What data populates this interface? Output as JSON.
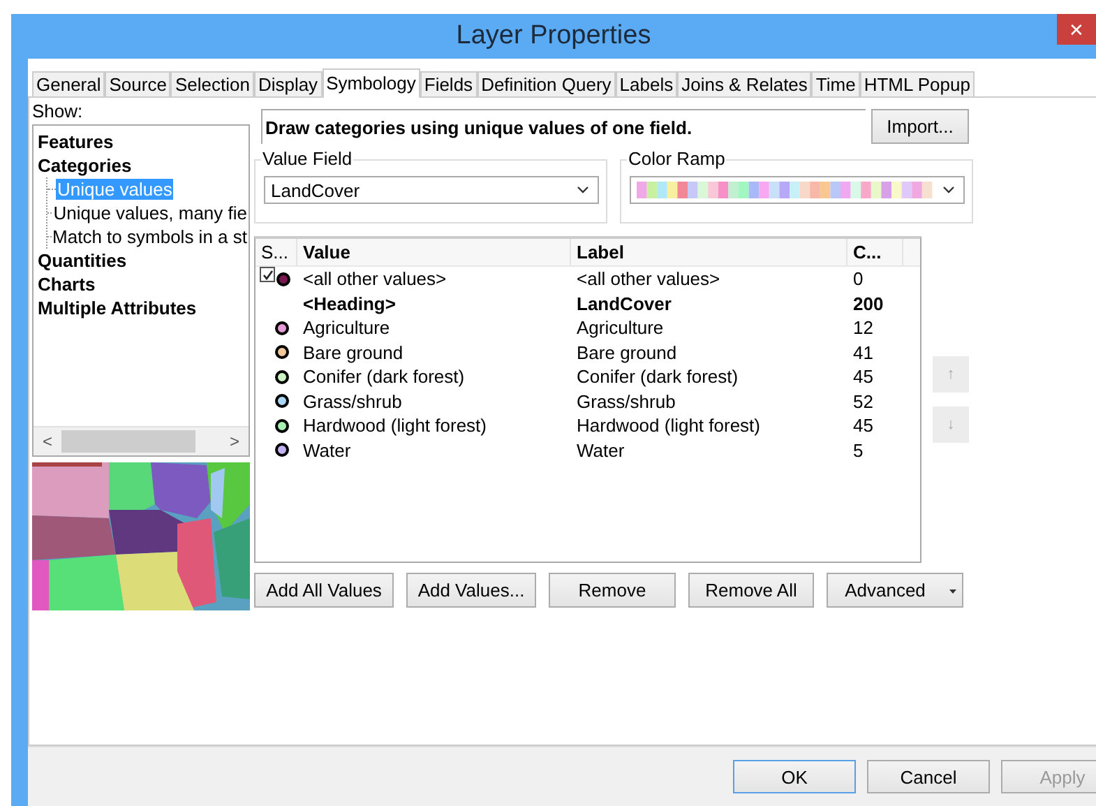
{
  "window": {
    "title": "Layer Properties",
    "close": "✕"
  },
  "tabs": [
    {
      "label": "General",
      "selected": false
    },
    {
      "label": "Source",
      "selected": false
    },
    {
      "label": "Selection",
      "selected": false
    },
    {
      "label": "Display",
      "selected": false
    },
    {
      "label": "Symbology",
      "selected": true
    },
    {
      "label": "Fields",
      "selected": false
    },
    {
      "label": "Definition Query",
      "selected": false
    },
    {
      "label": "Labels",
      "selected": false
    },
    {
      "label": "Joins & Relates",
      "selected": false
    },
    {
      "label": "Time",
      "selected": false
    },
    {
      "label": "HTML Popup",
      "selected": false
    }
  ],
  "show": {
    "label": "Show:",
    "tree": [
      {
        "label": "Features",
        "selected": false
      },
      {
        "label": "Categories",
        "selected": false,
        "children": [
          {
            "label": "Unique values",
            "selected": true
          },
          {
            "label": "Unique values, many fie",
            "selected": false
          },
          {
            "label": "Match to symbols in a st",
            "selected": false
          }
        ]
      },
      {
        "label": "Quantities",
        "selected": false
      },
      {
        "label": "Charts",
        "selected": false
      },
      {
        "label": "Multiple Attributes",
        "selected": false
      }
    ],
    "scroll_left": "<",
    "scroll_right": ">"
  },
  "description": "Draw categories using unique values of one field.",
  "import_button": "Import...",
  "value_field": {
    "label": "Value Field",
    "value": "LandCover"
  },
  "color_ramp": {
    "label": "Color Ramp"
  },
  "table": {
    "columns": [
      "S...",
      "Value",
      "Label",
      "C..."
    ],
    "rows": [
      {
        "kind": "other",
        "checked": true,
        "color": "#7a1650",
        "value": "<all other values>",
        "label": "<all other values>",
        "count": "0"
      },
      {
        "kind": "heading",
        "value": "<Heading>",
        "label": "LandCover",
        "count": "200"
      },
      {
        "kind": "class",
        "color": "#e89ad6",
        "value": "Agriculture",
        "label": "Agriculture",
        "count": "12"
      },
      {
        "kind": "class",
        "color": "#f2c89c",
        "value": "Bare ground",
        "label": "Bare ground",
        "count": "41"
      },
      {
        "kind": "class",
        "color": "#cdf2c4",
        "value": "Conifer (dark forest)",
        "label": "Conifer (dark forest)",
        "count": "45"
      },
      {
        "kind": "class",
        "color": "#a9d6f2",
        "value": "Grass/shrub",
        "label": "Grass/shrub",
        "count": "52"
      },
      {
        "kind": "class",
        "color": "#a6f0b2",
        "value": "Hardwood (light forest)",
        "label": "Hardwood (light forest)",
        "count": "45"
      },
      {
        "kind": "class",
        "color": "#c3b2f2",
        "value": "Water",
        "label": "Water",
        "count": "5"
      }
    ]
  },
  "move_buttons": [
    {
      "label": "↑",
      "disabled": true
    },
    {
      "label": "↓",
      "disabled": true
    }
  ],
  "action_buttons": [
    "Add All Values",
    "Add Values...",
    "Remove",
    "Remove All",
    "Advanced"
  ],
  "dialog_buttons": [
    {
      "label": "OK",
      "focused": true,
      "disabled": false
    },
    {
      "label": "Cancel",
      "focused": false,
      "disabled": false
    },
    {
      "label": "Apply",
      "focused": false,
      "disabled": true
    }
  ]
}
